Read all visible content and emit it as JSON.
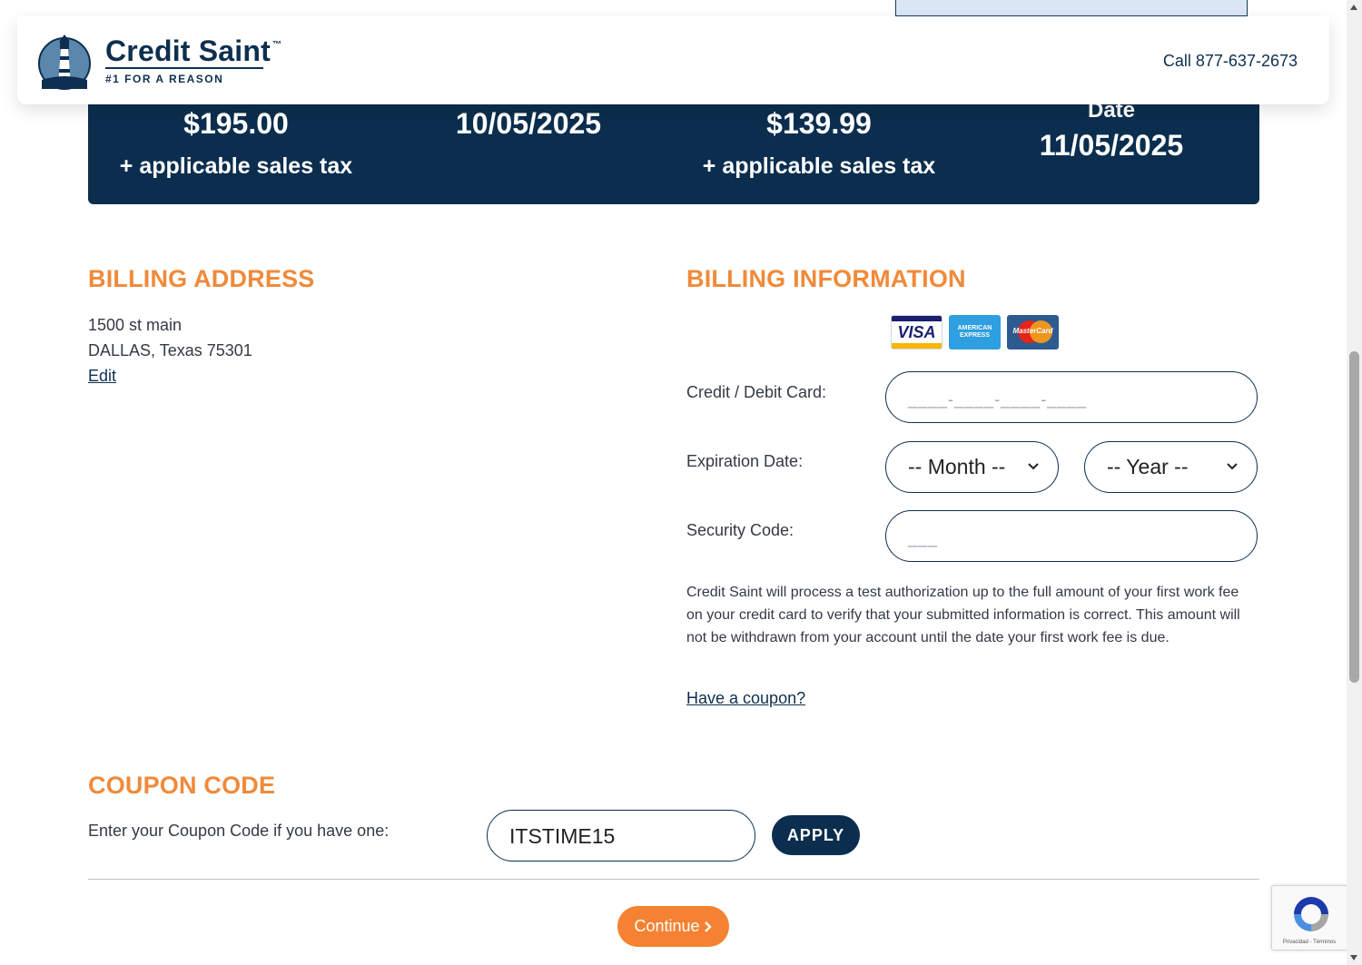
{
  "header": {
    "brand_name": "Credit Saint",
    "trademark": "™",
    "tagline": "#1 FOR A REASON",
    "phone": "Call 877-637-2673"
  },
  "summary": {
    "first_fee_amount": "$195.00",
    "first_fee_tax": "+ applicable sales tax",
    "first_fee_date": "10/05/2025",
    "monthly_amount": "$139.99",
    "monthly_tax": "+ applicable sales tax",
    "next_label": "Date",
    "next_date": "11/05/2025"
  },
  "billing_address": {
    "title": "BILLING ADDRESS",
    "line1": "1500 st main",
    "line2": "DALLAS, Texas 75301",
    "edit_label": "Edit"
  },
  "billing_info": {
    "title": "BILLING INFORMATION",
    "cards": {
      "visa": "VISA",
      "amex": "AMERICAN EXPRESS",
      "mastercard": "MasterCard"
    },
    "card_label": "Credit / Debit Card:",
    "card_placeholder": "____-____-____-____",
    "expiration_label": "Expiration Date:",
    "month_selected": "-- Month --",
    "year_selected": "-- Year --",
    "security_label": "Security Code:",
    "security_placeholder": "___",
    "note": "Credit Saint will process a test authorization up to the full amount of your first work fee on your credit card to verify that your submitted information is correct. This amount will not be withdrawn from your account until the date your first work fee is due.",
    "coupon_link": "Have a coupon?"
  },
  "coupon": {
    "title": "COUPON CODE",
    "label": "Enter your Coupon Code if you have one:",
    "value": "ITSTIME15",
    "apply_label": "APPLY"
  },
  "actions": {
    "continue_label": "Continue",
    "continue_icon": "chevron-right-icon"
  },
  "recaptcha": {
    "footer": "Privacidad - Términos"
  },
  "colors": {
    "navy": "#0b2e4e",
    "orange": "#f08a3a",
    "button_orange": "#f58232"
  }
}
